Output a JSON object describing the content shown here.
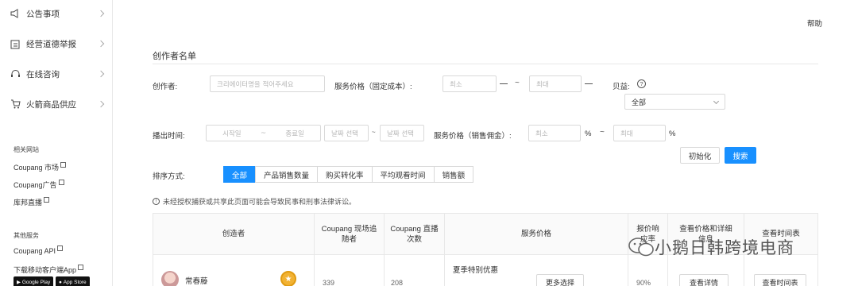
{
  "sidebar": {
    "nav": [
      {
        "label": "公告事项",
        "icon": "megaphone-icon"
      },
      {
        "label": "经营道德举报",
        "icon": "clipboard-icon"
      },
      {
        "label": "在线咨询",
        "icon": "headset-icon"
      },
      {
        "label": "火箭商品供应",
        "icon": "cart-icon"
      }
    ],
    "related_title": "相关网站",
    "related_links": [
      "Coupang 市场",
      "Coupang广告",
      "库邦直播"
    ],
    "services_title": "其他服务",
    "service_links": [
      "Coupang API",
      "下载移动客户端App"
    ],
    "store_badges": [
      "Google Play",
      "App Store"
    ]
  },
  "header": {
    "help": "帮助"
  },
  "page_title": "创作者名单",
  "filters": {
    "creator_label": "创作者:",
    "creator_placeholder": "크리에이터명을 적어주세요",
    "fixed_price_label": "服务价格（固定成本）:",
    "min_placeholder": "최소",
    "max_placeholder": "최대",
    "tilde": "~",
    "badge_label": "贝益:",
    "badge_select": "全部",
    "time_label": "播出时间:",
    "start_date": "시작일",
    "end_date": "종료일",
    "date_pick_1": "날짜 선택",
    "date_pick_2": "날짜 선택",
    "commission_label": "服务价格（销售佣金）:",
    "percent": "%",
    "reset_button": "初始化",
    "search_button": "搜索"
  },
  "sort": {
    "label": "排序方式:",
    "options": [
      "全部",
      "产品销售数量",
      "购买转化率",
      "平均观看时间",
      "销售额"
    ],
    "active_index": 0
  },
  "notice": "未经授权捕获或共享此页面可能会导致民事和刑事法律诉讼。",
  "table": {
    "headers": [
      "创造者",
      "Coupang 现场追随者",
      "Coupang 直播次数",
      "服务价格",
      "报价响应率",
      "查看价格和详细信息",
      "查看时间表"
    ],
    "rows": [
      {
        "name": "常春藤",
        "followers": "339",
        "broadcasts": "208",
        "price_note": "夏季特别优惠",
        "more_button": "更多选择",
        "response": "90%",
        "details_button": "查看详情",
        "schedule_button": "查看时间表"
      }
    ]
  },
  "watermark": "小鹅日韩跨境电商"
}
